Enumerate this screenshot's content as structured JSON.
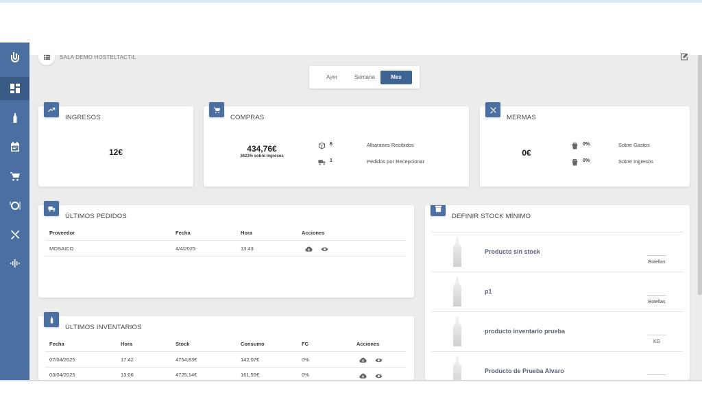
{
  "header": {
    "sala_name": "SALA DEMO HOSTELTACTIL"
  },
  "period": {
    "options": [
      "Ayer",
      "Semana",
      "Mes"
    ],
    "selected": "Mes"
  },
  "ingresos": {
    "title": "INGRESOS",
    "value": "12€"
  },
  "compras": {
    "title": "COMPRAS",
    "value": "434,76€",
    "subtitle": "3623% sobre Ingresos",
    "stats": [
      {
        "icon": "box-icon",
        "num": "6",
        "label": "Albaranes Recibidos"
      },
      {
        "icon": "truck-icon",
        "num": "1",
        "label": "Pedidos por Recepcionar"
      }
    ]
  },
  "mermas": {
    "title": "MERMAS",
    "value": "0€",
    "stats": [
      {
        "icon": "trash-icon",
        "num": "0%",
        "label": "Sobre Gastos"
      },
      {
        "icon": "trash-icon",
        "num": "0%",
        "label": "Sobre Ingresos"
      }
    ]
  },
  "ultimos_pedidos": {
    "title": "ÚLTIMOS PEDIDOS",
    "columns": [
      "Proveedor",
      "Fecha",
      "Hora",
      "Acciones"
    ],
    "rows": [
      {
        "proveedor": "MOSAICO",
        "fecha": "4/4/2025",
        "hora": "13:43"
      }
    ]
  },
  "ultimos_inventarios": {
    "title": "ÚLTIMOS INVENTARIOS",
    "columns": [
      "Fecha",
      "Hora",
      "Stock",
      "Consumo",
      "FC",
      "Acciones"
    ],
    "rows": [
      {
        "fecha": "07/04/2025",
        "hora": "17:42",
        "stock": "4754,83€",
        "consumo": "142,07€",
        "fc": "0%"
      },
      {
        "fecha": "03/04/2025",
        "hora": "13:06",
        "stock": "4725,14€",
        "consumo": "161,55€",
        "fc": "0%"
      }
    ]
  },
  "stock_minimo": {
    "title": "DEFINIR STOCK MÍNIMO",
    "items": [
      {
        "name": "Producto sin stock",
        "unit": "Botellas"
      },
      {
        "name": "p1",
        "unit": "Botellas"
      },
      {
        "name": "producto inventario prueba",
        "unit": "KG"
      },
      {
        "name": "Producto de Prueba Alvaro",
        "unit": ""
      }
    ]
  },
  "sidebar": {
    "items": [
      {
        "name": "logo-icon"
      },
      {
        "name": "dashboard-icon"
      },
      {
        "name": "bottle-icon"
      },
      {
        "name": "calendar-icon"
      },
      {
        "name": "cart-icon"
      },
      {
        "name": "plate-icon"
      },
      {
        "name": "utensils-icon"
      },
      {
        "name": "waveform-icon"
      }
    ]
  },
  "colors": {
    "accent": "#4a6fa0",
    "accent_dark": "#3e6493"
  }
}
